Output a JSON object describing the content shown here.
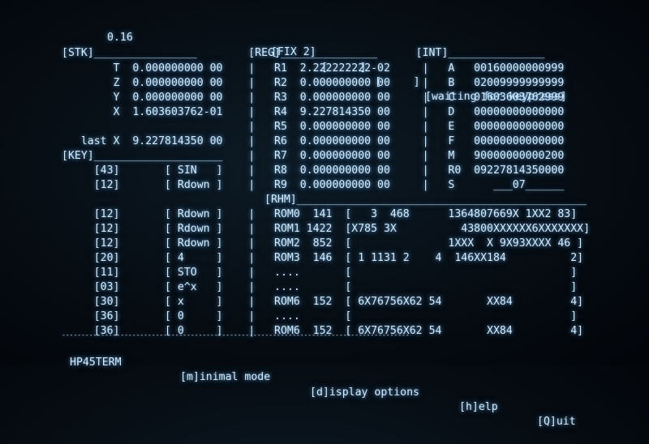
{
  "status_bar": {
    "version": "0.16",
    "display_mode": "[FIX 2]",
    "slot1": "[     ]",
    "slot2": "[     ]",
    "message": "[waiting for keypress]"
  },
  "section_headers": "[STK]________________        [REG]_______________      [INT]_______________",
  "rows": [
    {
      "stack": "        T  0.000000000 00",
      "reg": "    |   R1  2.222222222-02 ",
      "int": "    |   A   00160000000999"
    },
    {
      "stack": "        Z  0.000000000 00",
      "reg": "    |   R2  0.000000000 00 ",
      "int": "    |   B   02009999999999"
    },
    {
      "stack": "        Y  0.000000000 00",
      "reg": "    |   R3  0.000000000 00 ",
      "int": "    |   C   01603603762999"
    },
    {
      "stack": "        X  1.603603762-01",
      "reg": "    |   R4  9.227814350 00 ",
      "int": "    |   D   00000000000000"
    },
    {
      "stack": "                         ",
      "reg": "    |   R5  0.000000000 00 ",
      "int": "    |   E   00000000000000"
    },
    {
      "stack": "   last X  9.227814350 00",
      "reg": "    |   R6  0.000000000 00 ",
      "int": "    |   F   00000000000000"
    },
    {
      "stack": "[KEY]____________________",
      "reg": "    |   R7  0.000000000 00 ",
      "int": "    |   M   90000000000200"
    },
    {
      "stack": "     [43]       [ SIN   ]",
      "reg": "    |   R8  0.000000000 00 ",
      "int": "    |   R0  09227814350000"
    },
    {
      "stack": "     [12]       [ Rdown ]",
      "reg": "    |   R9  0.000000000 00 ",
      "int": "    |   S      ___07______"
    }
  ],
  "rom_header": "[RHM]_____________________________________________",
  "key_rows": [
    {
      "keycode": "     [12]       [ Rdown ]",
      "rom": "    |   ROM0  141  [   3  468      1364807669X 1XX2 83]"
    },
    {
      "keycode": "     [12]       [ Rdown ]",
      "rom": "    |   ROM1 1422  [X785 3X          43800XXXXXX6XXXXXXX]"
    },
    {
      "keycode": "     [12]       [ Rdown ]",
      "rom": "    |   ROM2  852  [               1XXX  X 9X93XXXX 46 ]"
    },
    {
      "keycode": "     [20]       [ 4     ]",
      "rom": "    |   ROM3  146  [ 1 1131 2    4  146XX184          2]"
    },
    {
      "keycode": "     [11]       [ STO   ]",
      "rom": "    |   ....       [                                  ]"
    },
    {
      "keycode": "     [03]       [ e^x   ]",
      "rom": "    |   ....       [                                  ]"
    },
    {
      "keycode": "     [30]       [ x     ]",
      "rom": "    |   ROM6  152  [ 6X76756X62 54       XX84         4]"
    },
    {
      "keycode": "     [36]       [ 0     ]",
      "rom": "    |   ....       [                                  ]"
    },
    {
      "keycode": "     [36]       [ 0     ]",
      "rom": "    |   ROM6  152  [ 6X76756X62 54       XX84         4]"
    }
  ],
  "divider": "-----------------------------------------------------------------------------------------",
  "footer": {
    "app_name": "HP45TERM",
    "minimal": "[m]inimal mode",
    "display": "[d]isplay options",
    "help": "[h]elp",
    "quit": "[Q]uit"
  }
}
